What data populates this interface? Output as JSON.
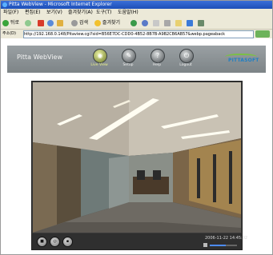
{
  "window": {
    "title": "Pitta WebView - Microsoft Internet Explorer"
  },
  "menubar": {
    "items": [
      "파일(F)",
      "편집(E)",
      "보기(V)",
      "즐겨찾기(A)",
      "도구(T)",
      "도움말(H)"
    ]
  },
  "toolbar": {
    "back_label": "뒤로",
    "search_label": "검색",
    "favorites_label": "즐겨찾기"
  },
  "addressbar": {
    "label": "주소(D)",
    "url": "http://192.168.0.148/Pitaview.cgi?sid=B56E7DC-CDD0-4B52-8B7B-A9B2CB6AB57&webp.pageaback"
  },
  "app": {
    "title": "Pitta WebView",
    "nav": [
      {
        "label": "Live View",
        "icon": "camera-icon",
        "active": true
      },
      {
        "label": "Setup",
        "icon": "wrench-icon",
        "active": false
      },
      {
        "label": "Help",
        "icon": "help-icon",
        "active": false
      },
      {
        "label": "Logout",
        "icon": "logout-icon",
        "active": false
      }
    ],
    "logo_text": "PITTASOFT"
  },
  "viewer": {
    "timestamp": "2006-11-22 14:45:02",
    "volume_level": 0.6
  },
  "colors": {
    "header_bg": "#8b9194",
    "active_nav": "#e9f08a",
    "logo_blue": "#1d7fc4",
    "logo_green": "#7ac143"
  }
}
